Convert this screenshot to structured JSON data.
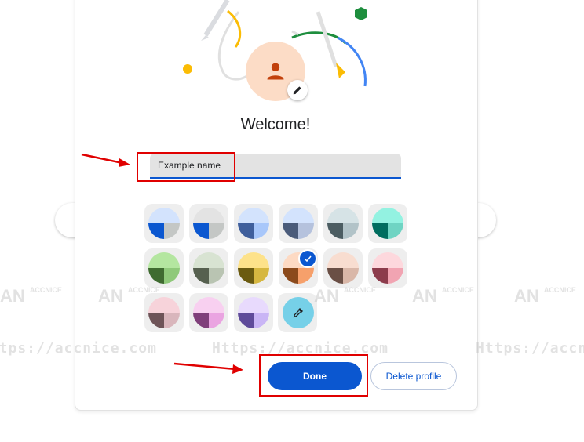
{
  "dialog": {
    "title": "Welcome!",
    "name_field": {
      "value": "Example name",
      "placeholder": ""
    },
    "done_label": "Done",
    "delete_label": "Delete profile"
  },
  "colors": {
    "accent": "#0b57d0",
    "avatar_bg": "#fcdcc6",
    "avatar_icon": "#c2410c",
    "annotation": "#e00000"
  },
  "swatches": [
    {
      "top": "#d3e3fd",
      "bl": "#0b57d0",
      "br": "#c4c7c5"
    },
    {
      "top": "#e3e3e3",
      "bl": "#0b57d0",
      "br": "#c4c7c5"
    },
    {
      "top": "#d3e3fd",
      "bl": "#3f5f9c",
      "br": "#a8c7fa"
    },
    {
      "top": "#d3e3fd",
      "bl": "#4a5b7a",
      "br": "#b5c2dd"
    },
    {
      "top": "#d6e3e6",
      "bl": "#4c5d62",
      "br": "#b2c3c8"
    },
    {
      "top": "#93f2e1",
      "bl": "#006d5f",
      "br": "#6fd4c3"
    },
    {
      "top": "#b4e6a0",
      "bl": "#3f6b30",
      "br": "#8fc97a"
    },
    {
      "top": "#d8e3d2",
      "bl": "#56604f",
      "br": "#b9c4b2"
    },
    {
      "top": "#fde28a",
      "bl": "#6b5b10",
      "br": "#d6b740"
    },
    {
      "top": "#fddac3",
      "bl": "#8b4a1c",
      "br": "#f6a06b"
    },
    {
      "top": "#f8ddd0",
      "bl": "#6a4f45",
      "br": "#d9b7a8"
    },
    {
      "top": "#fdd8dd",
      "bl": "#8c3c4c",
      "br": "#f1a4b2"
    },
    {
      "top": "#f7d3da",
      "bl": "#6e5458",
      "br": "#d9b6bc"
    },
    {
      "top": "#f8d0f0",
      "bl": "#7f3f7a",
      "br": "#eaa4e1"
    },
    {
      "top": "#e8dafd",
      "bl": "#5f4b9a",
      "br": "#c9b5f5"
    }
  ],
  "watermark": {
    "logo": "ACCNICE",
    "url": "Https://accnice.com"
  }
}
